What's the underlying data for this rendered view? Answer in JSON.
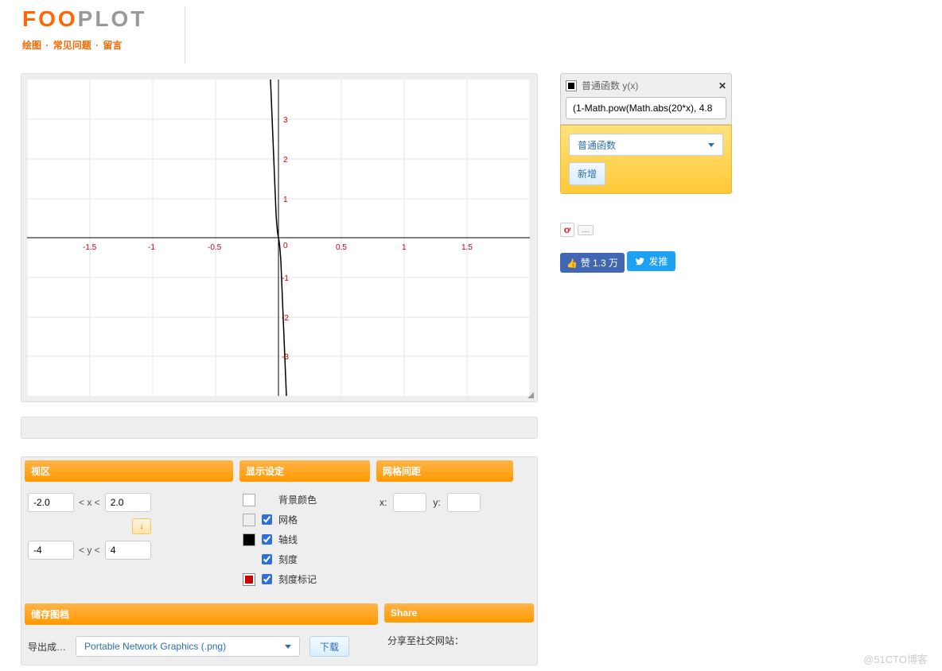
{
  "logo": {
    "part1": "F",
    "part2": "OO",
    "part3": "PL",
    "part4": "O",
    "part5": "T"
  },
  "nav": {
    "plot": "绘图",
    "faq": "常见问题",
    "msg": "留言",
    "sep": "·"
  },
  "chart_data": {
    "type": "line",
    "title": "",
    "xlabel": "",
    "ylabel": "",
    "xlim": [
      -2,
      2
    ],
    "ylim": [
      -4,
      4
    ],
    "x_ticks": [
      -1.5,
      -1,
      -0.5,
      0,
      0.5,
      1,
      1.5
    ],
    "y_ticks": [
      -3,
      -2,
      -1,
      1,
      2,
      3
    ],
    "series": [
      {
        "name": "普通函数 y(x)",
        "expression": "(1-Math.pow(Math.abs(20*x), 4.8",
        "color": "#000000",
        "x": [
          -0.06,
          -0.05,
          -0.04,
          -0.03,
          -0.02,
          -0.01,
          0,
          0.01,
          0.02,
          0.03,
          0.04,
          0.05,
          0.06
        ],
        "y": [
          4,
          2.8,
          1.2,
          0.5,
          0.15,
          0.01,
          0,
          -0.01,
          -0.15,
          -0.5,
          -1.2,
          -2.8,
          -4
        ]
      }
    ]
  },
  "sidebar": {
    "fn_label": "普通函数 y(x)",
    "fn_value": "(1-Math.pow(Math.abs(20*x), 4.8",
    "type_dd": "普通函数",
    "add_btn": "新增"
  },
  "social": {
    "fb": "赞 1.3 万",
    "tw": "发推",
    "dots": "…"
  },
  "settings": {
    "viewport_hdr": "视区",
    "display_hdr": "显示设定",
    "grid_hdr": "网格间距",
    "save_hdr": "储存图档",
    "share_hdr": "Share",
    "xmin": "-2.0",
    "xmax": "2.0",
    "ymin": "-4",
    "ymax": "4",
    "xlt": "< x <",
    "ylt": "< y <",
    "arrow": "↓",
    "opt_bg": "背景颜色",
    "opt_grid": "网格",
    "opt_axis": "轴线",
    "opt_tick": "刻度",
    "opt_ticklabel": "刻度标记",
    "grid_x_label": "x:",
    "grid_y_label": "y:",
    "grid_x": "",
    "grid_y": "",
    "export_label": "导出成…",
    "format": "Portable Network Graphics (.png)",
    "download": "下载",
    "share_text": "分享至社交网站："
  },
  "watermark": "@51CTO博客"
}
